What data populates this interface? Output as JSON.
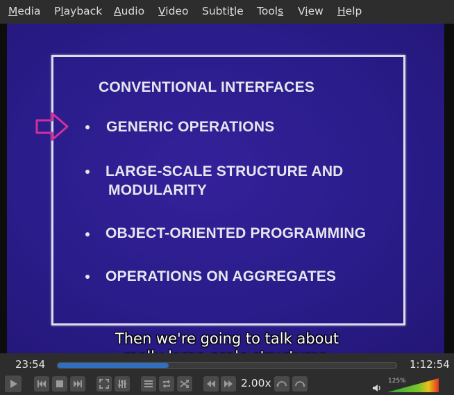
{
  "menu": {
    "items": [
      {
        "pre": "",
        "u": "M",
        "post": "edia"
      },
      {
        "pre": "P",
        "u": "l",
        "post": "ayback"
      },
      {
        "pre": "",
        "u": "A",
        "post": "udio"
      },
      {
        "pre": "",
        "u": "V",
        "post": "ideo"
      },
      {
        "pre": "Subti",
        "u": "t",
        "post": "le"
      },
      {
        "pre": "Tool",
        "u": "s",
        "post": ""
      },
      {
        "pre": "V",
        "u": "i",
        "post": "ew"
      },
      {
        "pre": "",
        "u": "H",
        "post": "elp"
      }
    ]
  },
  "slide": {
    "title": "CONVENTIONAL INTERFACES",
    "bullets": [
      "GENERIC OPERATIONS",
      "LARGE-SCALE STRUCTURE AND",
      "MODULARITY",
      "OBJECT-ORIENTED PROGRAMMING",
      "OPERATIONS ON AGGREGATES"
    ]
  },
  "subtitle": {
    "line1": "Then we're going to talk about",
    "line2": "really large-scale structures."
  },
  "player": {
    "elapsed": "23:54",
    "total": "1:12:54",
    "progress_fraction": 0.328,
    "rate": "2.00x",
    "volume_label": "125%",
    "volume_fraction": 1.0
  },
  "colors": {
    "accent": "#2f6fbf",
    "slide_bg": "#2a1c8a",
    "arrow": "#d0309a"
  }
}
